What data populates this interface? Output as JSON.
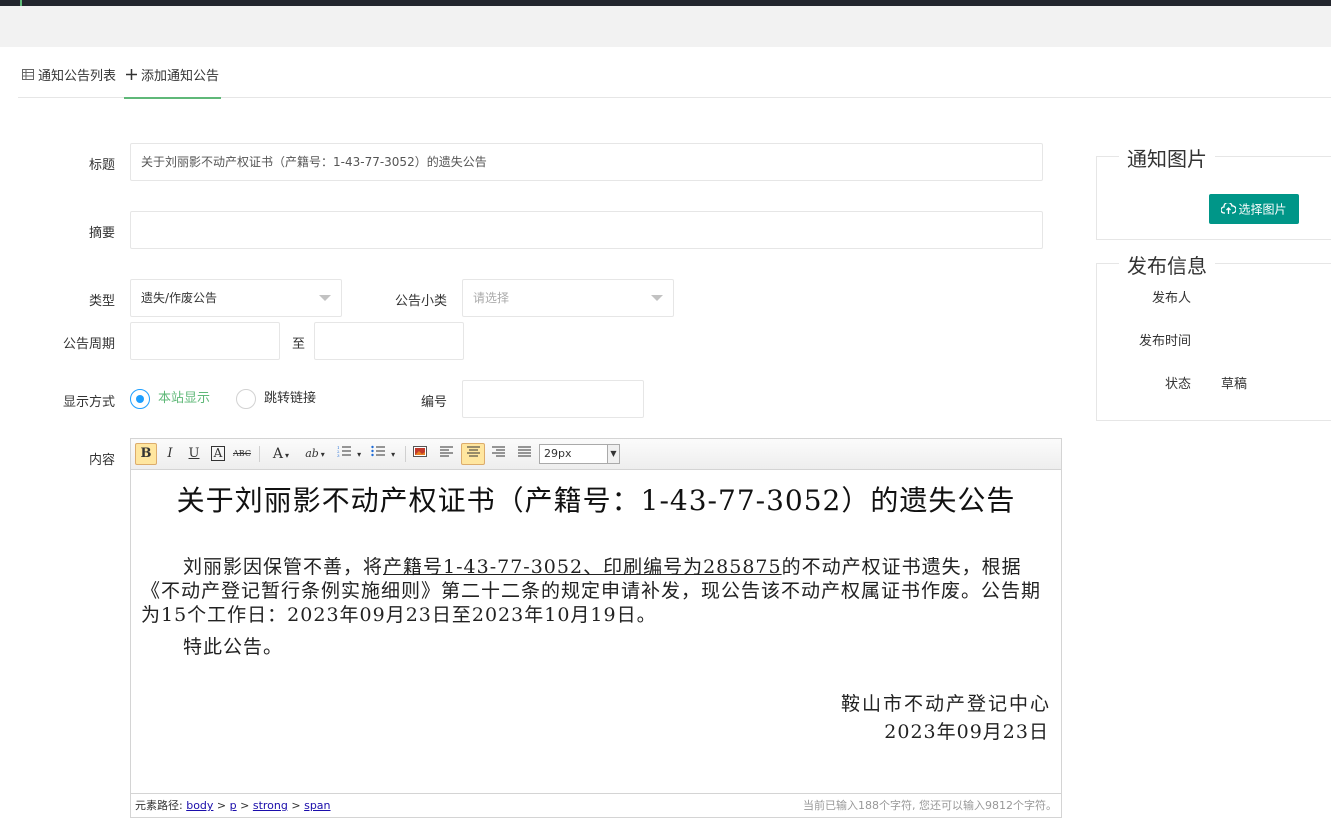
{
  "tabs": [
    {
      "label": "通知公告列表",
      "icon": "table-icon"
    },
    {
      "label": "添加通知公告",
      "icon": "plus-icon"
    }
  ],
  "form": {
    "title": {
      "label": "标题",
      "value": "关于刘丽影不动产权证书（产籍号：1-43-77-3052）的遗失公告"
    },
    "summary": {
      "label": "摘要",
      "value": ""
    },
    "type": {
      "label": "类型",
      "value": "遗失/作废公告"
    },
    "subtype": {
      "label": "公告小类",
      "placeholder": "请选择"
    },
    "period": {
      "label": "公告周期",
      "from": "",
      "to_label": "至",
      "to": ""
    },
    "display": {
      "label": "显示方式",
      "options": [
        "本站显示",
        "跳转链接"
      ],
      "selected": "本站显示"
    },
    "number": {
      "label": "编号",
      "value": ""
    },
    "content_label": "内容"
  },
  "editor": {
    "toolbar": {
      "bold": "B",
      "italic": "I",
      "underline": "U",
      "font_border": "A",
      "strike": "ABC",
      "font_color": "A",
      "highlight": "ab",
      "font_size": "29px"
    },
    "doc_title": "关于刘丽影不动产权证书（产籍号：1-43-77-3052）的遗失公告",
    "para_pre": "刘丽影因保管不善，将",
    "para_underlined": "产籍号1-43-77-3052、印刷编号为285875",
    "para_post": "的不动产权证书遗失，根据《不动产登记暂行条例实施细则》第二十二条的规定申请补发，现公告该不动产权属证书作废。公告期为15个工作日：2023年09月23日至2023年10月19日。",
    "para2": "特此公告。",
    "sign_org": "鞍山市不动产登记中心",
    "sign_date": "2023年09月23日",
    "status": {
      "path_label": "元素路径:",
      "path": [
        "body",
        "p",
        "strong",
        "span"
      ],
      "count": "当前已输入188个字符, 您还可以输入9812个字符。"
    }
  },
  "sidebar": {
    "image_panel": {
      "title": "通知图片",
      "button": "选择图片"
    },
    "publish_panel": {
      "title": "发布信息",
      "publisher_label": "发布人",
      "publisher": "",
      "time_label": "发布时间",
      "time": "",
      "status_label": "状态",
      "status": "草稿"
    }
  },
  "colors": {
    "accent": "#5fb878",
    "button": "#009688",
    "radio": "#1e9fff"
  }
}
